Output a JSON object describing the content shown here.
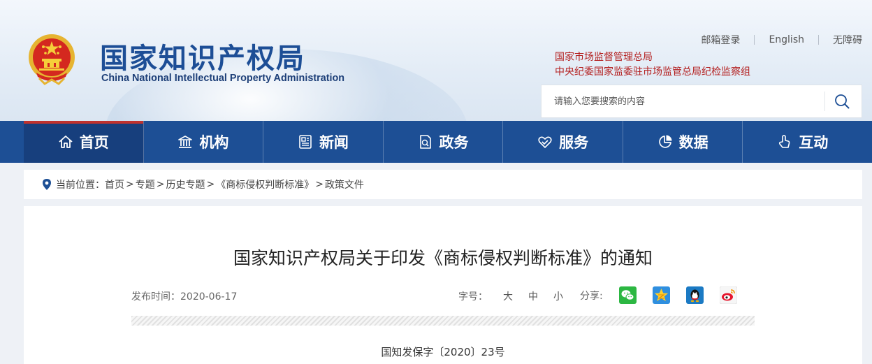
{
  "header": {
    "logo_cn": "国家知识产权局",
    "logo_en": "China National Intellectual Property Administration",
    "top_links": [
      "邮箱登录",
      "English",
      "无障碍"
    ],
    "supervisor_lines": [
      "国家市场监督管理总局",
      "中央纪委国家监委驻市场监管总局纪检监察组"
    ],
    "search": {
      "placeholder": "请输入您要搜索的内容"
    }
  },
  "nav": {
    "items": [
      {
        "label": "首页",
        "icon": "home-icon",
        "active": true
      },
      {
        "label": "机构",
        "icon": "institution-icon"
      },
      {
        "label": "新闻",
        "icon": "news-icon"
      },
      {
        "label": "政务",
        "icon": "government-affairs-icon"
      },
      {
        "label": "服务",
        "icon": "service-icon"
      },
      {
        "label": "数据",
        "icon": "data-pie-icon"
      },
      {
        "label": "互动",
        "icon": "interaction-hand-icon"
      }
    ]
  },
  "breadcrumb": {
    "prefix": "当前位置：",
    "items": [
      "首页",
      "专题",
      "历史专题",
      "《商标侵权判断标准》",
      "政策文件"
    ]
  },
  "article": {
    "title": "国家知识产权局关于印发《商标侵权判断标准》的通知",
    "publish_time": "发布时间：2020-06-17",
    "font_size_label": "字号：",
    "font_sizes": [
      "大",
      "中",
      "小"
    ],
    "share_label": "分享:",
    "share_icons": [
      "wechat-icon",
      "qzone-icon",
      "qq-icon",
      "weibo-icon"
    ],
    "doc_number": "国知发保字〔2020〕23号"
  },
  "colors": {
    "nav_bg": "#1d4f95",
    "nav_active_bg": "#173f7d",
    "nav_active_bar": "#c0322e",
    "logo_text": "#1d4e96",
    "supervisor_text": "#b31d1d"
  }
}
